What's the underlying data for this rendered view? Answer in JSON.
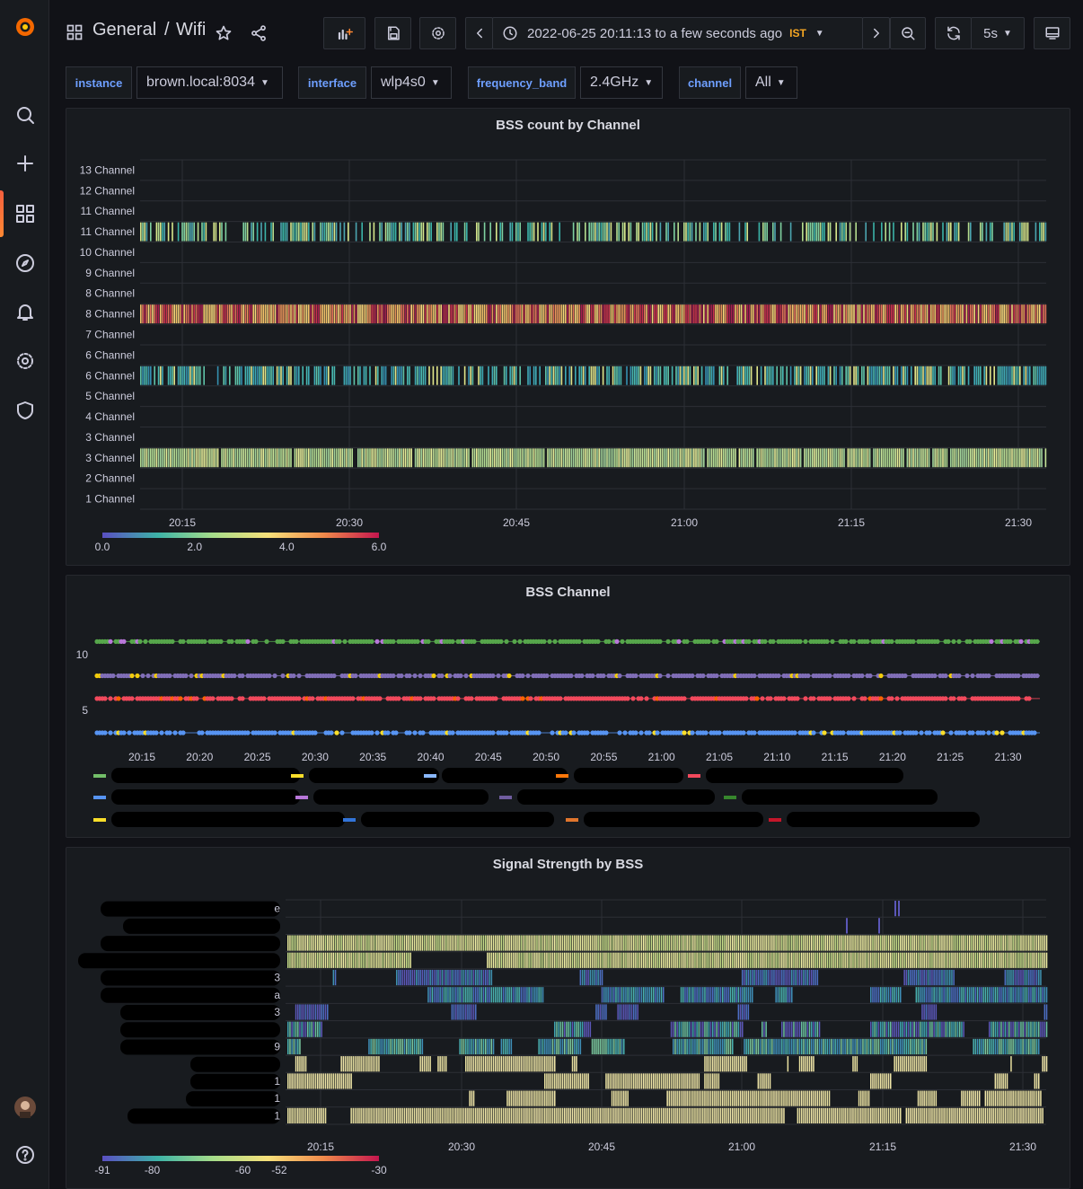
{
  "breadcrumb": {
    "folder": "General",
    "separator": "/",
    "dashboard": "Wifi"
  },
  "time_range": {
    "text": "2022-06-25 20:11:13 to a few seconds ago",
    "tz": "IST"
  },
  "refresh": {
    "interval": "5s"
  },
  "variables": [
    {
      "name": "instance",
      "value": "brown.local:8034"
    },
    {
      "name": "interface",
      "value": "wlp4s0"
    },
    {
      "name": "frequency_band",
      "value": "2.4GHz"
    },
    {
      "name": "channel",
      "value": "All"
    }
  ],
  "colors": {
    "accent": "#f55f3e",
    "link": "#6e9fff",
    "bg": "#111217",
    "panel": "#181b1f"
  },
  "chart_data": [
    {
      "type": "heatmap",
      "title": "BSS count by Channel",
      "y_categories": [
        "13 Channel",
        "12 Channel",
        "11 Channel",
        "11 Channel",
        "10 Channel",
        "9 Channel",
        "8 Channel",
        "8 Channel",
        "7 Channel",
        "6 Channel",
        "6 Channel",
        "5 Channel",
        "4 Channel",
        "3 Channel",
        "3 Channel",
        "2 Channel",
        "1 Channel"
      ],
      "x_ticks": [
        "20:15",
        "20:30",
        "20:45",
        "21:00",
        "21:15",
        "21:30"
      ],
      "active_rows": [
        {
          "row": 3,
          "density": 0.55,
          "palette": "teal-yellow"
        },
        {
          "row": 7,
          "density": 1.0,
          "palette": "warm"
        },
        {
          "row": 10,
          "density": 0.7,
          "palette": "teal"
        },
        {
          "row": 14,
          "density": 0.95,
          "palette": "yellow-green"
        }
      ],
      "color_scale": {
        "min": 0.0,
        "max": 6.0,
        "ticks": [
          "0.0",
          "2.0",
          "4.0",
          "6.0"
        ]
      }
    },
    {
      "type": "scatter",
      "title": "BSS Channel",
      "y_ticks": [
        "10",
        "5"
      ],
      "x_ticks": [
        "20:15",
        "20:20",
        "20:25",
        "20:30",
        "20:35",
        "20:40",
        "20:45",
        "20:50",
        "20:55",
        "21:00",
        "21:05",
        "21:10",
        "21:15",
        "21:20",
        "21:25",
        "21:30"
      ],
      "series_levels": [
        {
          "y": 11,
          "color": "#56a64b",
          "alt": "#b877d9"
        },
        {
          "y": 8,
          "color": "#806eb7",
          "alt": "#f2cc0c"
        },
        {
          "y": 6,
          "color": "#f2495c",
          "alt": "#fa6400"
        },
        {
          "y": 3,
          "color": "#5794f2",
          "alt": "#fade2a"
        }
      ],
      "legend_colors": [
        "#73bf69",
        "#fade2a",
        "#8ab8ff",
        "#ff780a",
        "#f2495c",
        "#5794f2",
        "#b877d9",
        "#705da0",
        "#37872d",
        "#fade2a",
        "#3274d9",
        "#e0752d",
        "#c4162a"
      ]
    },
    {
      "type": "heatmap",
      "title": "Signal Strength by BSS",
      "x_ticks": [
        "20:15",
        "20:30",
        "20:45",
        "21:00",
        "21:15",
        "21:30"
      ],
      "row_suffixes": [
        "e",
        "",
        "",
        "",
        "3",
        "a",
        "3",
        "",
        "9",
        "",
        "1",
        "1",
        "1"
      ],
      "color_scale": {
        "min": -91,
        "max": -30,
        "ticks": [
          "-91",
          "-80",
          "-60",
          "-52",
          "-30"
        ]
      }
    }
  ]
}
